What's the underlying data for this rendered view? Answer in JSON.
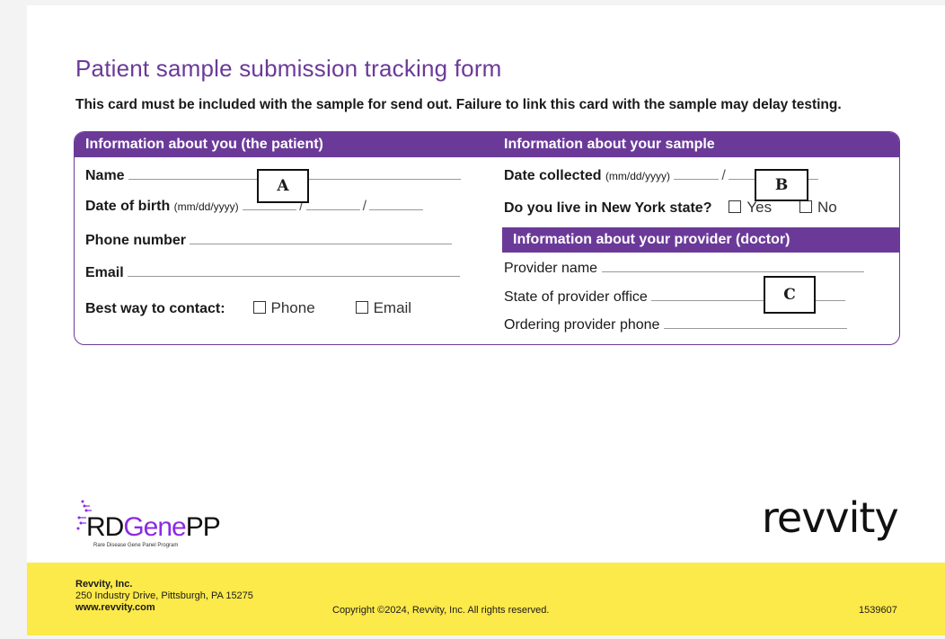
{
  "form": {
    "title": "Patient sample submission tracking form",
    "subtitle": "This card must be included with the sample for send out. Failure to link this card with the sample may delay testing."
  },
  "patient": {
    "header": "Information about you (the patient)",
    "name_label": "Name",
    "dob_label": "Date of birth",
    "dob_format": "(mm/dd/yyyy)",
    "phone_label": "Phone number",
    "email_label": "Email",
    "contact_label": "Best way to contact:",
    "contact_opt_phone": "Phone",
    "contact_opt_email": "Email"
  },
  "sample": {
    "header": "Information about your sample",
    "date_label": "Date collected",
    "date_format": "(mm/dd/yyyy)",
    "ny_label": "Do you live in New York state?",
    "ny_opt_yes": "Yes",
    "ny_opt_no": "No"
  },
  "provider": {
    "header": "Information about your provider (doctor)",
    "name_label": "Provider name",
    "state_label": "State of provider office",
    "phone_label": "Ordering provider phone"
  },
  "markers": {
    "a": "A",
    "b": "B",
    "c": "C"
  },
  "logos": {
    "left_rd": "RD",
    "left_gene": "Gene",
    "left_pp": "PP",
    "left_tagline": "Rare Disease Gene Panel Program",
    "right": "revvity"
  },
  "footer": {
    "company": "Revvity, Inc.",
    "address": "250 Industry Drive, Pittsburgh, PA 15275",
    "website": "www.revvity.com",
    "copyright": "Copyright ©2024, Revvity, Inc. All rights reserved.",
    "doc_number": "1539607"
  },
  "colors": {
    "brand_purple": "#6b3a99",
    "footer_yellow": "#fce94a"
  }
}
